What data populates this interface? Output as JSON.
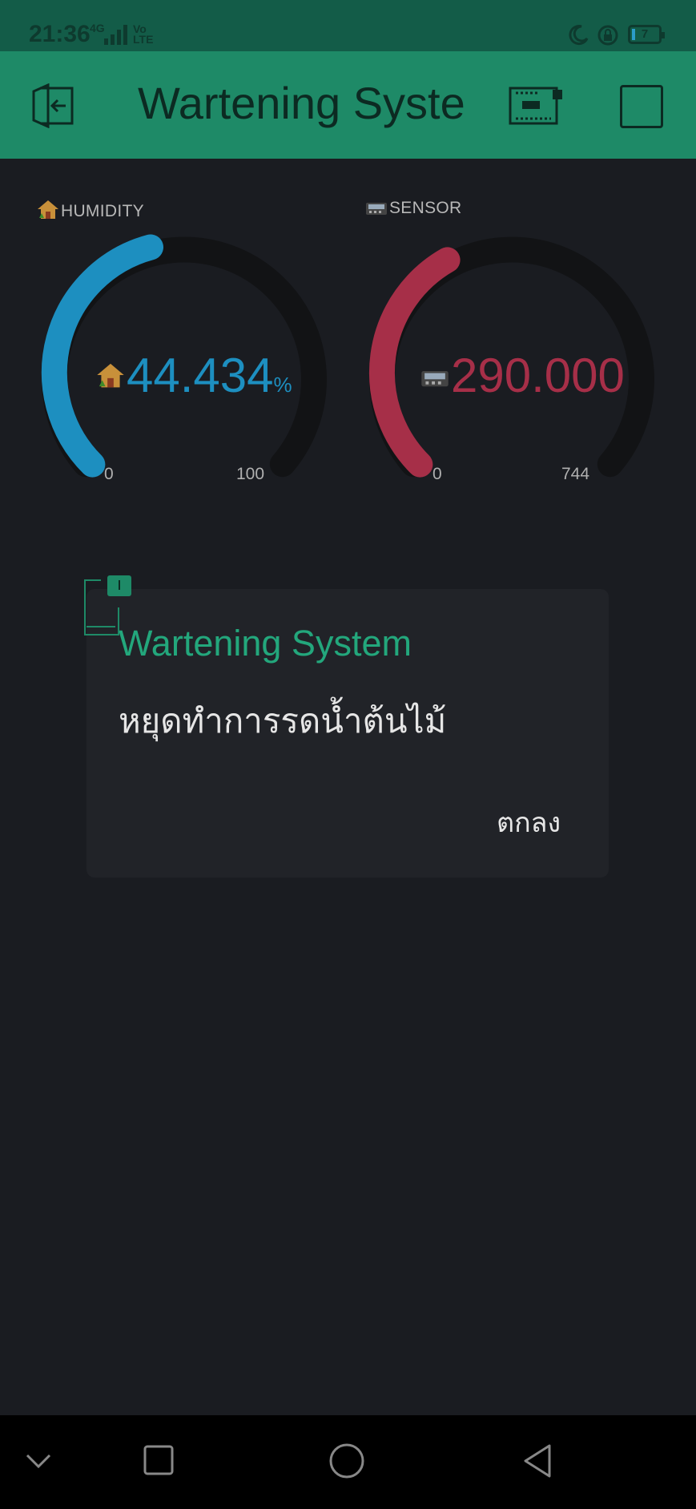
{
  "status": {
    "time": "21:36",
    "network": "4G",
    "volte": [
      "Vo",
      "LTE"
    ],
    "battery": "7"
  },
  "header": {
    "title": "Wartening System"
  },
  "gauges": [
    {
      "label": "HUMIDITY",
      "icon": "house-icon",
      "value": "44.434",
      "unit": "%",
      "min": "0",
      "max": "100",
      "level": 0.44434,
      "color": "#1d8fc0"
    },
    {
      "label": "SENSOR",
      "icon": "pager-icon",
      "value": "290.000",
      "unit": "",
      "min": "0",
      "max": "744",
      "level": 0.3898,
      "color": "#a62f48"
    }
  ],
  "dialog": {
    "title": "Wartening System",
    "message": "หยุดทำการรดน้ำต้นไม้",
    "ok_label": "ตกลง"
  },
  "colors": {
    "header": "#1e8a67",
    "background": "#1a1c21",
    "accent": "#23a77c"
  }
}
